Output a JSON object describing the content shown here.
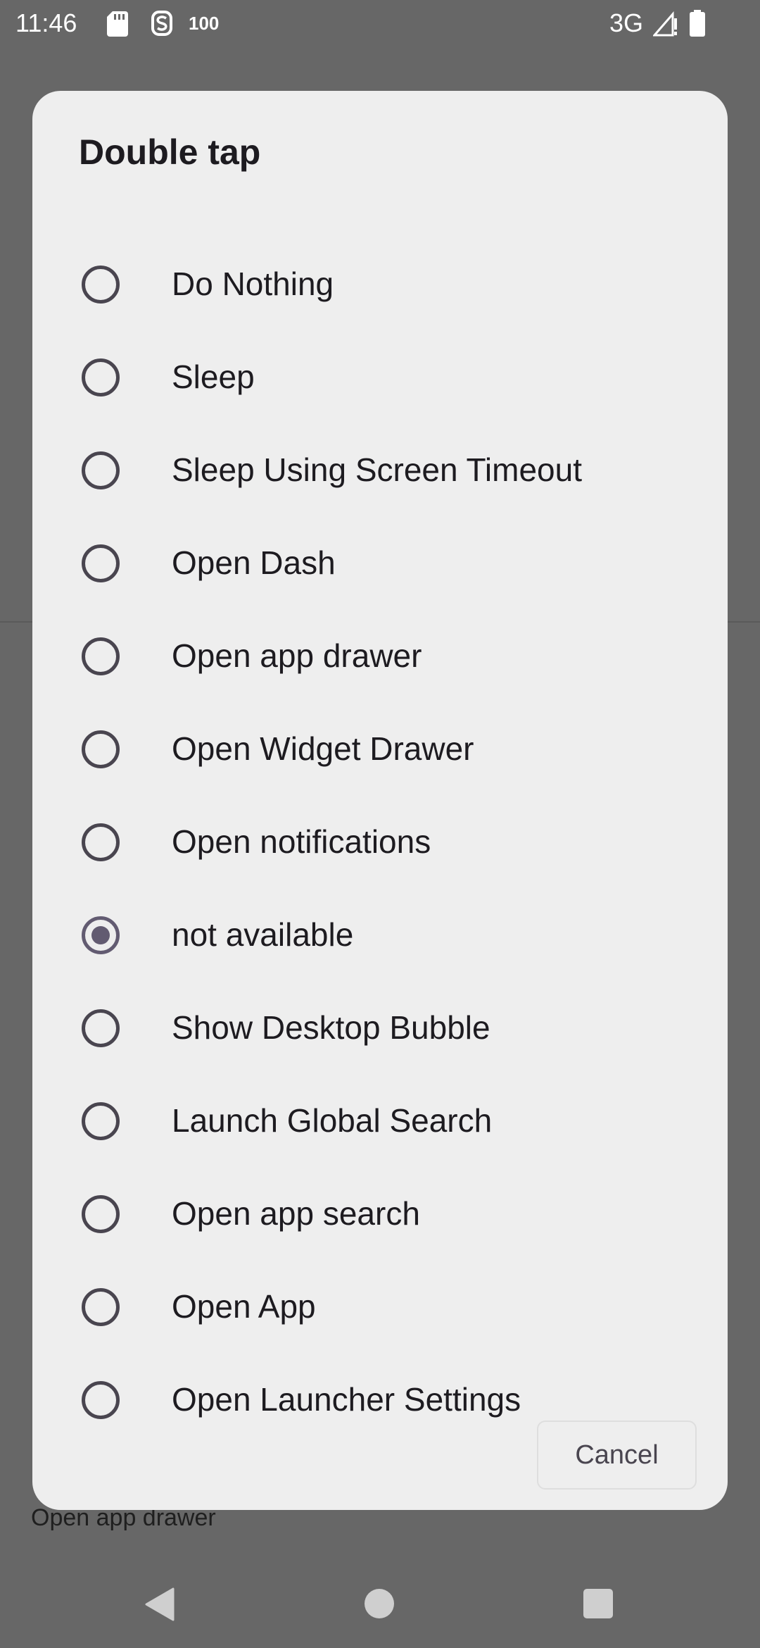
{
  "status_bar": {
    "time": "11:46",
    "battery_level_text": "100",
    "network": "3G",
    "icons": [
      "sd-card-icon",
      "s-app-icon",
      "signal-icon",
      "battery-icon"
    ]
  },
  "background": {
    "visible_text": "Open app drawer"
  },
  "dialog": {
    "title": "Double tap",
    "selected_index": 7,
    "options": [
      {
        "label": "Do Nothing",
        "checked": false
      },
      {
        "label": "Sleep",
        "checked": false
      },
      {
        "label": "Sleep Using Screen Timeout",
        "checked": false
      },
      {
        "label": "Open Dash",
        "checked": false
      },
      {
        "label": "Open app drawer",
        "checked": false
      },
      {
        "label": "Open Widget Drawer",
        "checked": false
      },
      {
        "label": "Open notifications",
        "checked": false
      },
      {
        "label": "not available",
        "checked": true
      },
      {
        "label": "Show Desktop Bubble",
        "checked": false
      },
      {
        "label": "Launch Global Search",
        "checked": false
      },
      {
        "label": "Open app search",
        "checked": false
      },
      {
        "label": "Open App",
        "checked": false
      },
      {
        "label": "Open Launcher Settings",
        "checked": false
      }
    ],
    "cancel_label": "Cancel"
  },
  "nav_bar": {
    "icons": [
      "back-icon",
      "home-icon",
      "recents-icon"
    ]
  },
  "colors": {
    "scrim": "#676767",
    "dialog_bg": "#eeeeee",
    "radio_selected": "#625b71",
    "radio_unselected": "#49454f"
  }
}
